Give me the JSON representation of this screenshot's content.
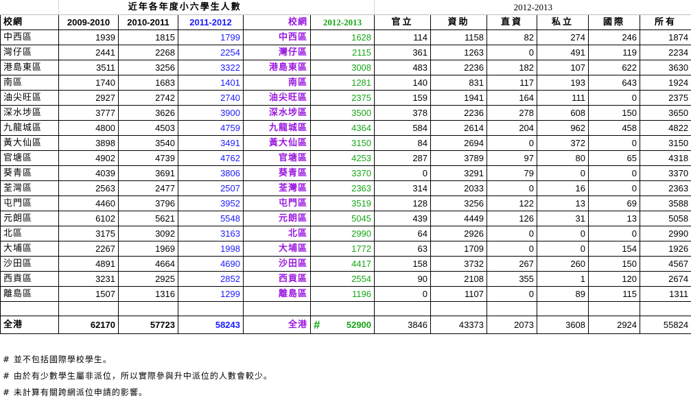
{
  "sheet_title": "近年各年度小六學生人數",
  "year_group_title": "2012-2013",
  "headers": {
    "district": "校網",
    "y2009": "2009-2010",
    "y2010": "2010-2011",
    "y2011": "2011-2012",
    "district2": "校網",
    "y2012": "2012-2013",
    "gov": "官立",
    "aided": "資助",
    "dss": "直資",
    "private": "私立",
    "intl": "國際",
    "all": "所有"
  },
  "rows": [
    {
      "name": "中西區",
      "y2009": "1939",
      "y2010": "1815",
      "y2011": "1799",
      "y2012": "1628",
      "gov": "114",
      "aided": "1158",
      "dss": "82",
      "private": "274",
      "intl": "246",
      "all": "1874"
    },
    {
      "name": "灣仔區",
      "y2009": "2441",
      "y2010": "2268",
      "y2011": "2254",
      "y2012": "2115",
      "gov": "361",
      "aided": "1263",
      "dss": "0",
      "private": "491",
      "intl": "119",
      "all": "2234"
    },
    {
      "name": "港島東區",
      "y2009": "3511",
      "y2010": "3256",
      "y2011": "3322",
      "y2012": "3008",
      "gov": "483",
      "aided": "2236",
      "dss": "182",
      "private": "107",
      "intl": "622",
      "all": "3630"
    },
    {
      "name": "南區",
      "y2009": "1740",
      "y2010": "1683",
      "y2011": "1401",
      "y2012": "1281",
      "gov": "140",
      "aided": "831",
      "dss": "117",
      "private": "193",
      "intl": "643",
      "all": "1924"
    },
    {
      "name": "油尖旺區",
      "y2009": "2927",
      "y2010": "2742",
      "y2011": "2740",
      "y2012": "2375",
      "gov": "159",
      "aided": "1941",
      "dss": "164",
      "private": "111",
      "intl": "0",
      "all": "2375"
    },
    {
      "name": "深水埗區",
      "y2009": "3777",
      "y2010": "3626",
      "y2011": "3900",
      "y2012": "3500",
      "gov": "378",
      "aided": "2236",
      "dss": "278",
      "private": "608",
      "intl": "150",
      "all": "3650"
    },
    {
      "name": "九龍城區",
      "y2009": "4800",
      "y2010": "4503",
      "y2011": "4759",
      "y2012": "4364",
      "gov": "584",
      "aided": "2614",
      "dss": "204",
      "private": "962",
      "intl": "458",
      "all": "4822"
    },
    {
      "name": "黃大仙區",
      "y2009": "3898",
      "y2010": "3540",
      "y2011": "3491",
      "y2012": "3150",
      "gov": "84",
      "aided": "2694",
      "dss": "0",
      "private": "372",
      "intl": "0",
      "all": "3150"
    },
    {
      "name": "官塘區",
      "y2009": "4902",
      "y2010": "4739",
      "y2011": "4762",
      "y2012": "4253",
      "gov": "287",
      "aided": "3789",
      "dss": "97",
      "private": "80",
      "intl": "65",
      "all": "4318"
    },
    {
      "name": "葵青區",
      "y2009": "4039",
      "y2010": "3691",
      "y2011": "3806",
      "y2012": "3370",
      "gov": "0",
      "aided": "3291",
      "dss": "79",
      "private": "0",
      "intl": "0",
      "all": "3370"
    },
    {
      "name": "荃灣區",
      "y2009": "2563",
      "y2010": "2477",
      "y2011": "2507",
      "y2012": "2363",
      "gov": "314",
      "aided": "2033",
      "dss": "0",
      "private": "16",
      "intl": "0",
      "all": "2363"
    },
    {
      "name": "屯門區",
      "y2009": "4460",
      "y2010": "3796",
      "y2011": "3952",
      "y2012": "3519",
      "gov": "128",
      "aided": "3256",
      "dss": "122",
      "private": "13",
      "intl": "69",
      "all": "3588"
    },
    {
      "name": "元朗區",
      "y2009": "6102",
      "y2010": "5621",
      "y2011": "5548",
      "y2012": "5045",
      "gov": "439",
      "aided": "4449",
      "dss": "126",
      "private": "31",
      "intl": "13",
      "all": "5058"
    },
    {
      "name": "北區",
      "y2009": "3175",
      "y2010": "3092",
      "y2011": "3163",
      "y2012": "2990",
      "gov": "64",
      "aided": "2926",
      "dss": "0",
      "private": "0",
      "intl": "0",
      "all": "2990"
    },
    {
      "name": "大埔區",
      "y2009": "2267",
      "y2010": "1969",
      "y2011": "1998",
      "y2012": "1772",
      "gov": "63",
      "aided": "1709",
      "dss": "0",
      "private": "0",
      "intl": "154",
      "all": "1926"
    },
    {
      "name": "沙田區",
      "y2009": "4891",
      "y2010": "4664",
      "y2011": "4690",
      "y2012": "4417",
      "gov": "158",
      "aided": "3732",
      "dss": "267",
      "private": "260",
      "intl": "150",
      "all": "4567"
    },
    {
      "name": "西貢區",
      "y2009": "3231",
      "y2010": "2925",
      "y2011": "2852",
      "y2012": "2554",
      "gov": "90",
      "aided": "2108",
      "dss": "355",
      "private": "1",
      "intl": "120",
      "all": "2674"
    },
    {
      "name": "離島區",
      "y2009": "1507",
      "y2010": "1316",
      "y2011": "1299",
      "y2012": "1196",
      "gov": "0",
      "aided": "1107",
      "dss": "0",
      "private": "89",
      "intl": "115",
      "all": "1311"
    }
  ],
  "total": {
    "name": "全港",
    "y2009": "62170",
    "y2010": "57723",
    "y2011": "58243",
    "hash": "#",
    "y2012": "52900",
    "gov": "3846",
    "aided": "43373",
    "dss": "2073",
    "private": "3608",
    "intl": "2924",
    "all": "55824"
  },
  "notes": [
    "# 並不包括國際學校學生。",
    "# 由於有少數學生屬非派位，所以實際參與升中派位的人數會較少。",
    "# 未計算有關跨網派位申請的影響。"
  ],
  "colors": {
    "blue": "#1a1aff",
    "purple": "#9a17e0",
    "green": "#15a515"
  }
}
